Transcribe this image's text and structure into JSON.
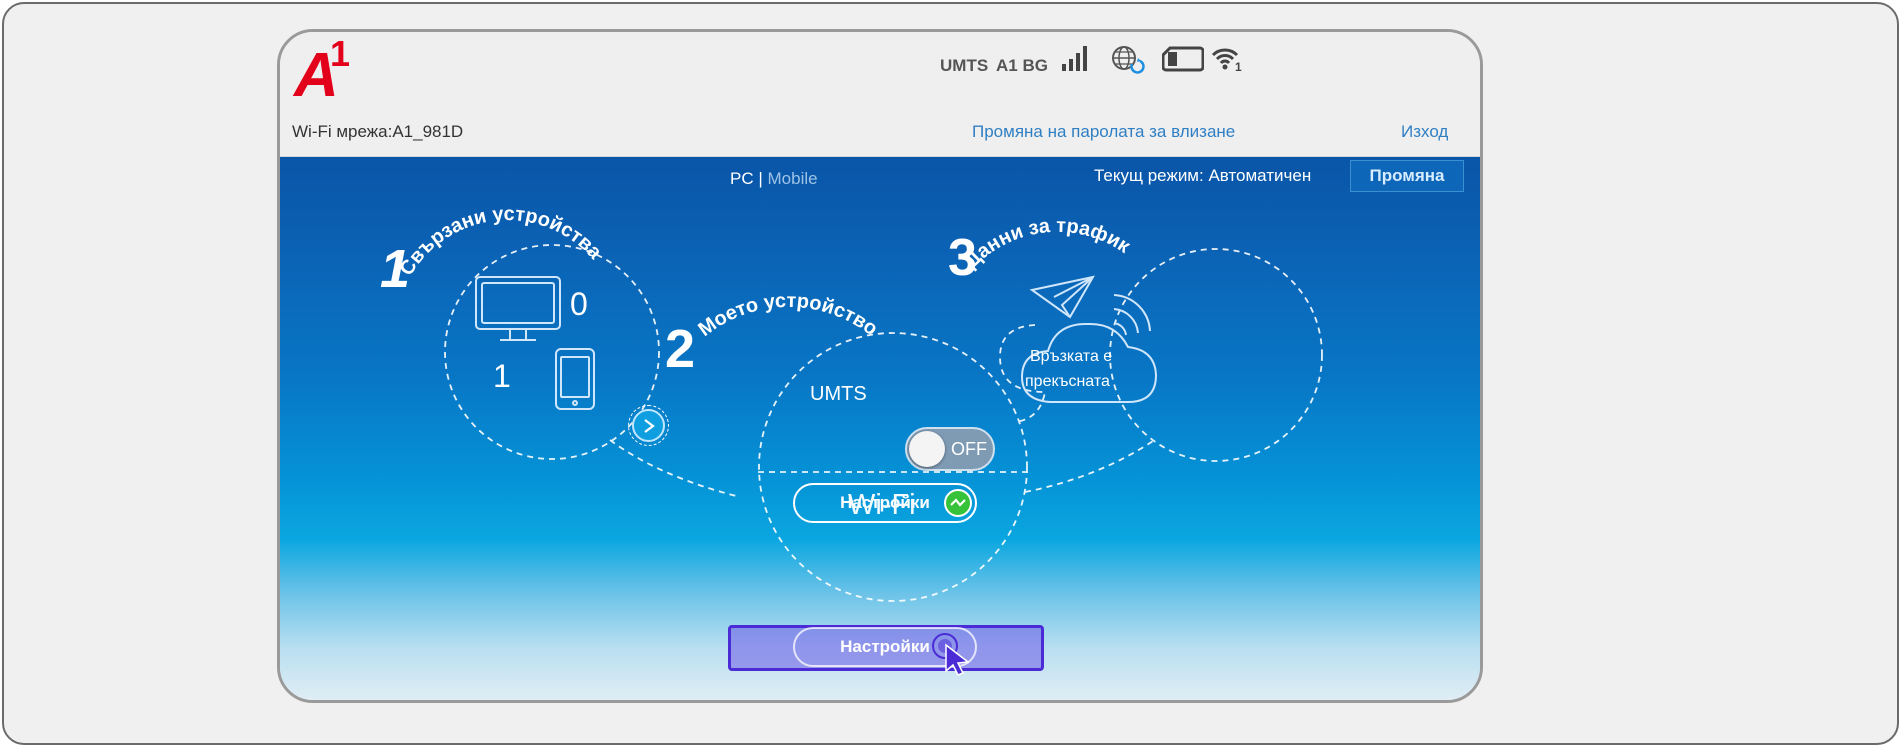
{
  "header": {
    "logo": {
      "letter": "A",
      "digit": "1",
      "color": "#e3001b"
    },
    "wifi_network": "Wi-Fi мрежа:A1_981D",
    "network_type": "UMTS",
    "operator": "A1 BG",
    "icons": [
      "signal-bars-icon",
      "globe-sync-icon",
      "sim-card-icon",
      "wifi-icon"
    ],
    "wifi_count": "1",
    "change_password_link": "Промяна на паролата за влизане",
    "logout_link": "Изход"
  },
  "view_switch": {
    "pc": "PC",
    "separator": "|",
    "mobile": "Mobile"
  },
  "mode": {
    "label": "Текущ режим: Автоматичен",
    "change_button": "Промяна"
  },
  "section_devices": {
    "number": "1",
    "title": "Свързани устройства",
    "computers_count": "0",
    "phones_count": "1"
  },
  "section_my_device": {
    "number": "2",
    "title": "Моето устройство",
    "umts_label": "UMTS",
    "toggle_state": "OFF",
    "settings_button": "Настройки",
    "wifi_label": "Wi-Fi",
    "wifi_settings_button": "Настройки"
  },
  "section_traffic": {
    "number": "3",
    "title": "Данни за трафик",
    "status_line1": "Връзката е",
    "status_line2": "прекъсната"
  },
  "colors": {
    "link": "#2f7fc4",
    "highlight": "#4b2bd6",
    "connector": "#36c33a"
  }
}
